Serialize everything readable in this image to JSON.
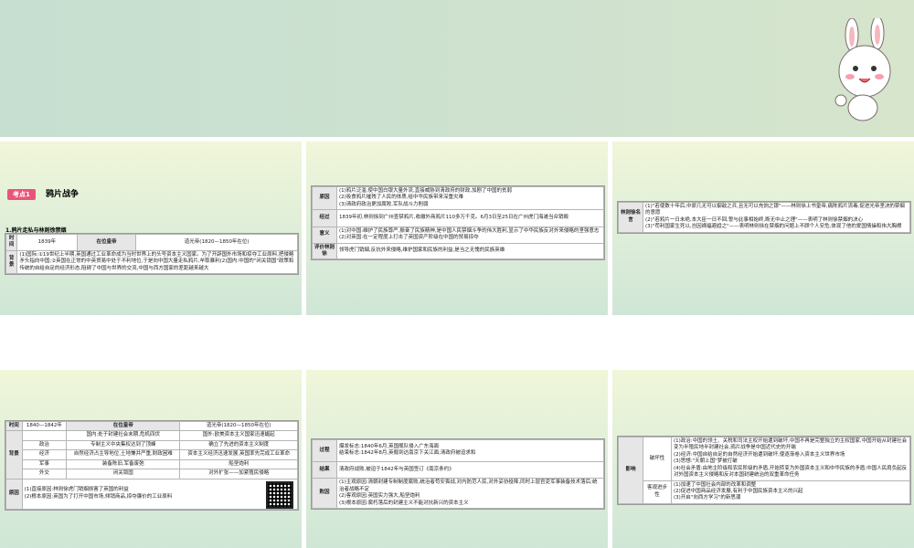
{
  "s1": {
    "tag": "考点1",
    "title": "鸦片战争",
    "section": "1.鸦片走私与林则徐禁烟",
    "row1": [
      "时间",
      "1839年",
      "在位皇帝",
      "道光帝(1820—1850年在位)"
    ],
    "bg_label": "背景",
    "bg_text": "(1)国际:①19世纪上半期,英国通过工业革命成为当时世界上的头号资本主义国家。为了开辟国外市场和掠夺工业原料,把侵略矛头指向中国;②英国在正常的中英贸易中处于不利地位,于是向中国大量走私鸦片,牟取暴利(2)国内:中国的\"闭关锁国\"政策和传统的自给自足的经济形态,阻碍了中国与世界的交流,中国与西方国家的差距越来越大"
  },
  "s2": {
    "rows": [
      {
        "label": "原因",
        "text": "(1)鸦片泛滥,使中国白银大量外流,直接威胁到清政府的财政,加剧了中国的贫弱\n(2)吸食鸦片摧残了人民的体质,给中华民族带来深重灾难\n(3)清政府政治更加腐败,军队战斗力削弱"
      },
      {
        "label": "经过",
        "text": "1839年初,林则徐到广州查禁鸦片,收缴外商鸦片110多万千克。6月3日至25日在广州虎门海滩当众销毁"
      },
      {
        "label": "意义",
        "text": "(1)对中国:维护了民族尊严,振奋了民族精神,是中国人民禁烟斗争的伟大胜利,显示了中华民族反对外来侵略的坚强意志\n(2)对英国:在一定程度上打击了英国资产阶级在中国的贸易掠夺"
      },
      {
        "label": "评价林则徐",
        "text": "领导虎门销烟,反抗外来侵略,维护国家和民族的利益,是当之无愧的民族英雄"
      }
    ]
  },
  "s3": {
    "label": "林则徐名言",
    "text": "(1)\"若使数十年后,中原几无可以御敌之兵,且无可以充饷之银\"——林则徐上书皇帝,痛陈鸦片流毒,促进光帝坚决的禁烟的意愿\n(2)\"若鸦片一日未绝,本大臣一日不回,誓与此事相始终,断无中止之理\"——表明了林则徐禁烟的决心\n(3)\"苟利国家生死以,岂因祸福避趋之\"——表明林则徐在禁烟的问题上不顾个人安危,体现了他的爱国情操和伟大胸襟"
  },
  "s4": {
    "head": [
      "时间",
      "1840—1842年",
      "在位皇帝",
      "道光帝(1820—1850年在位)"
    ],
    "bg_label": "背景",
    "bg_rows": [
      [
        "",
        "国内:处于封建社会末期,危机四伏",
        "国外:欧美资本主义国家迅速崛起"
      ],
      [
        "政治",
        "专制主义中央集权达到了顶峰",
        "确立了先进的资本主义制度"
      ],
      [
        "经济",
        "自然经济占主导地位,土地兼并严重,财政困难",
        "资本主义经济迅速发展,英国率先完成工业革命"
      ],
      [
        "军事",
        "装备陈旧,军备废弛",
        "船坚炮利"
      ],
      [
        "外交",
        "闭关锁国",
        "对外扩张——加紧殖民侵略"
      ]
    ],
    "cause_label": "原因",
    "cause_text": "(1)直接原因:林则徐虎门销烟损害了英国的利益\n(2)根本原因:英国为了打开中国市场,倾销商品,掠夺廉价的工业原料"
  },
  "s5": {
    "rows": [
      {
        "label": "过程",
        "text": "爆发标志:1840年6月,英国舰队侵入广东海面\n结束标志:1842年8月,英舰到达南京下关江面,清政府被迫求和"
      },
      {
        "label": "结果",
        "text": "清政府战败,被迫于1842年与英国签订《南京条约》"
      },
      {
        "label": "败因",
        "text": "(1)主观原因:清朝封建专制制度腐败,统治者苟安畏战,对内防范人民,对外妥协投降,同时上层官吏军事装备技术落后;统治者战略不定\n(2)客观原因:英国实力强大,船坚炮利\n(3)根本原因:腐朽落后的封建主义不能对抗新兴的资本主义"
      }
    ]
  },
  "s6": {
    "label": "影响",
    "sub1": "破坏性",
    "sub1_text": "(1)政治:中国的领土、关税和司法主权开始遭到破坏,中国不再是完整独立的主权国家,中国开始从封建社会变为半殖民地半封建社会,鸦片战争是中国近代史的开端\n(2)经济:中国自给自足的自然经济开始遭到破坏,使逐渐卷入资本主义世界市场\n(3)思想:\"天朝上国\"梦被打破\n(4)社会矛盾:由地主阶级和农民阶级的矛盾,开始转变为外国资本主义和中华民族的矛盾;中国人民肩负起反对外国资本主义侵略和反对本国封建统治的双重革命任务",
    "sub2": "客观进步性",
    "sub2_text": "(1)加速了中国社会内部的改革和调整\n(2)促进中国商品经济发展,有利于中国民族资本主义的兴起\n(3)开启\"向西方学习\"的新思潮"
  }
}
